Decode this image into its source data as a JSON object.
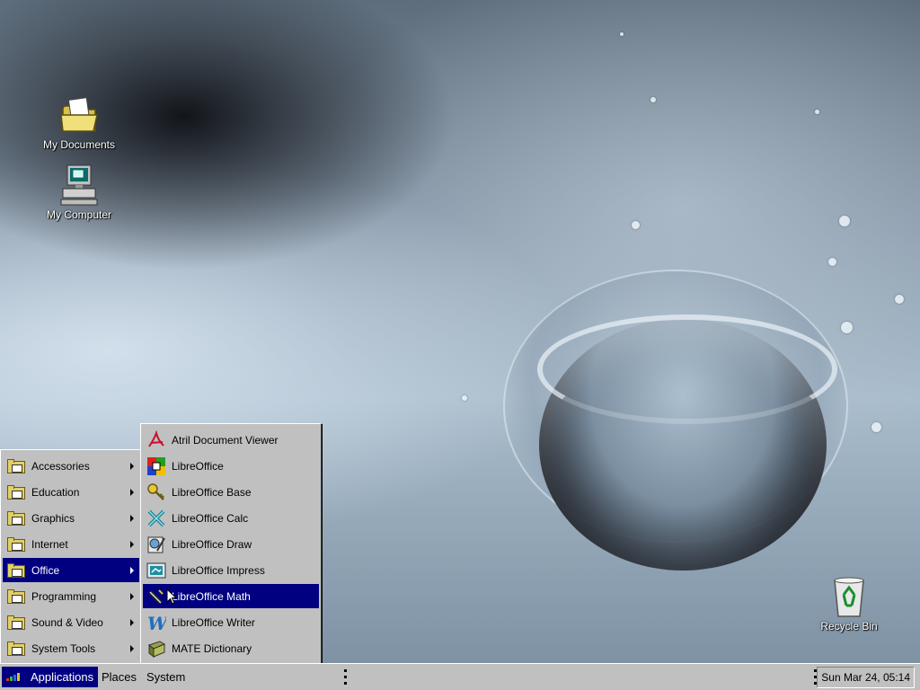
{
  "desktop": {
    "icons": [
      {
        "label": "My Documents",
        "icon": "folder-documents-icon"
      },
      {
        "label": "My Computer",
        "icon": "computer-icon"
      },
      {
        "label": "Recycle Bin",
        "icon": "recycle-bin-icon"
      }
    ]
  },
  "applications_menu": {
    "items": [
      {
        "label": "Accessories",
        "icon": "folder-icon",
        "submenu": true
      },
      {
        "label": "Education",
        "icon": "folder-icon",
        "submenu": true
      },
      {
        "label": "Graphics",
        "icon": "folder-icon",
        "submenu": true
      },
      {
        "label": "Internet",
        "icon": "folder-icon",
        "submenu": true
      },
      {
        "label": "Office",
        "icon": "folder-icon",
        "submenu": true,
        "selected": true
      },
      {
        "label": "Programming",
        "icon": "folder-icon",
        "submenu": true
      },
      {
        "label": "Sound & Video",
        "icon": "folder-icon",
        "submenu": true
      },
      {
        "label": "System Tools",
        "icon": "folder-icon",
        "submenu": true
      }
    ]
  },
  "office_submenu": {
    "items": [
      {
        "label": "Atril Document Viewer",
        "icon": "pdf-viewer-icon"
      },
      {
        "label": "LibreOffice",
        "icon": "libreoffice-icon"
      },
      {
        "label": "LibreOffice Base",
        "icon": "key-database-icon"
      },
      {
        "label": "LibreOffice Calc",
        "icon": "spreadsheet-icon"
      },
      {
        "label": "LibreOffice Draw",
        "icon": "drawing-icon"
      },
      {
        "label": "LibreOffice Impress",
        "icon": "presentation-icon"
      },
      {
        "label": "LibreOffice Math",
        "icon": "math-formula-icon",
        "selected": true
      },
      {
        "label": "LibreOffice Writer",
        "icon": "writer-icon"
      },
      {
        "label": "MATE Dictionary",
        "icon": "dictionary-book-icon"
      }
    ]
  },
  "taskbar": {
    "applications": "Applications",
    "places": "Places",
    "system": "System",
    "clock": "Sun Mar 24, 05:14"
  },
  "colors": {
    "menu_bg": "#c0c0c0",
    "selection": "#000080",
    "selection_text": "#ffffff"
  }
}
